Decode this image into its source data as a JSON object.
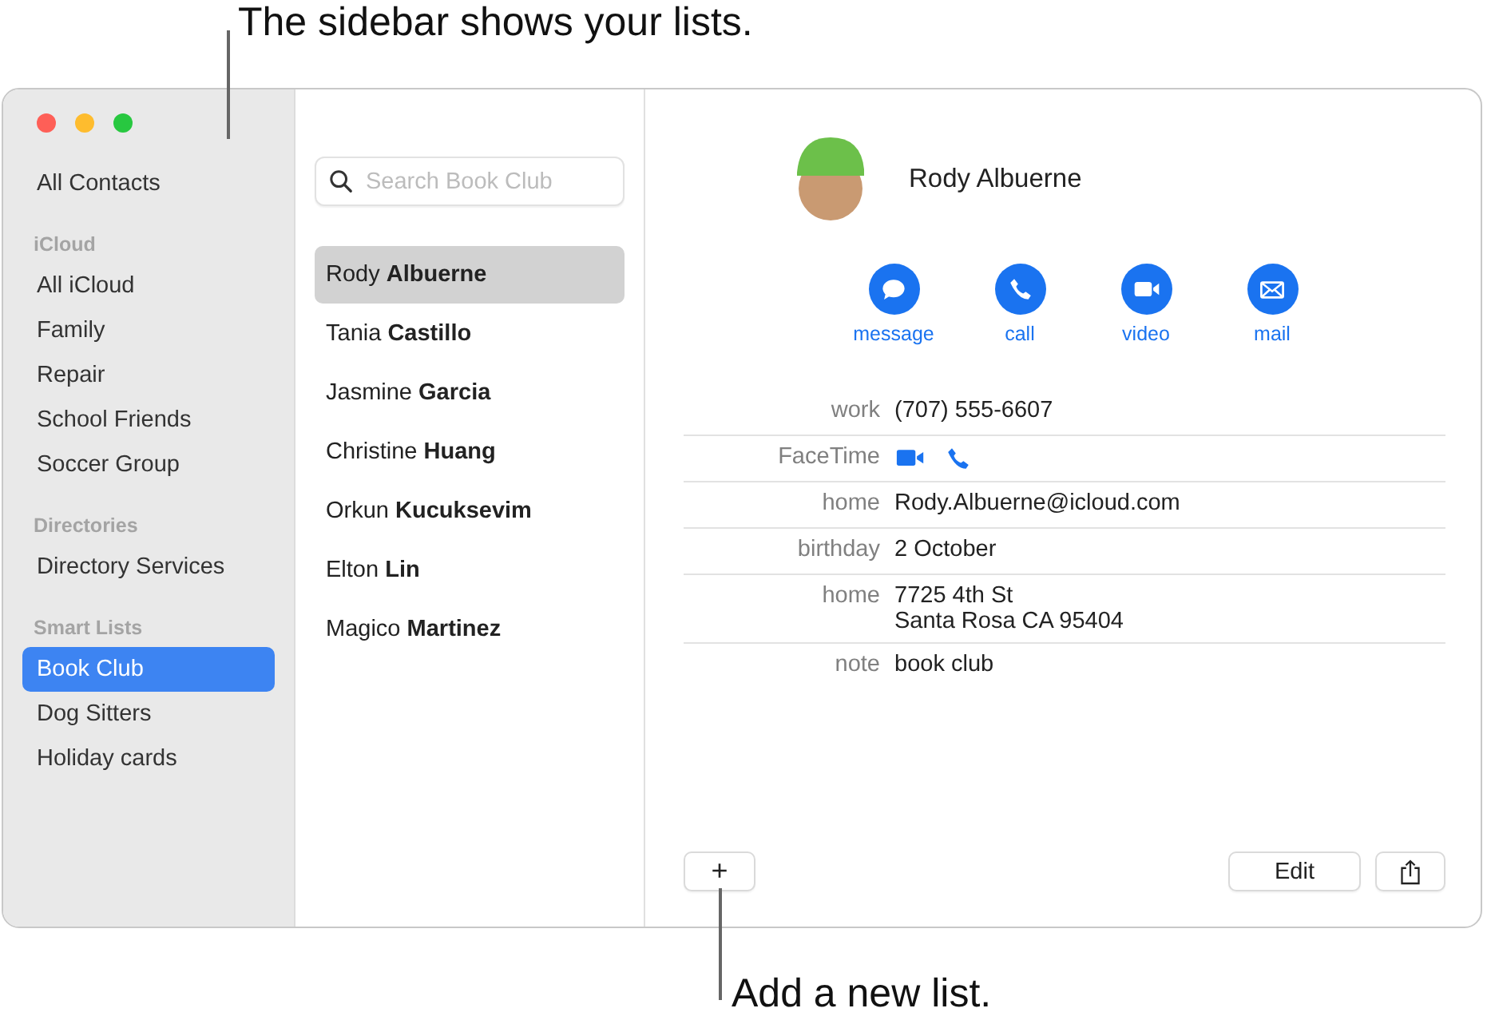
{
  "callouts": [
    {
      "kind": "sidebar",
      "text": "The sidebar shows your lists."
    },
    {
      "kind": "add",
      "text": "Add a new list."
    }
  ],
  "sidebar": {
    "top_item": {
      "label": "All Contacts",
      "selected": false
    },
    "sections": [
      {
        "heading": "iCloud",
        "items": [
          {
            "label": "All iCloud",
            "selected": false
          },
          {
            "label": "Family",
            "selected": false
          },
          {
            "label": "Repair",
            "selected": false
          },
          {
            "label": "School Friends",
            "selected": false
          },
          {
            "label": "Soccer Group",
            "selected": false
          }
        ]
      },
      {
        "heading": "Directories",
        "items": [
          {
            "label": "Directory Services",
            "selected": false
          }
        ]
      },
      {
        "heading": "Smart Lists",
        "items": [
          {
            "label": "Book Club",
            "selected": true
          },
          {
            "label": "Dog Sitters",
            "selected": false
          },
          {
            "label": "Holiday cards",
            "selected": false
          }
        ]
      }
    ]
  },
  "contact_list": {
    "search": {
      "placeholder": "Search Book Club"
    },
    "contacts": [
      {
        "name": "Rody **Albuerne**",
        "selected": true
      },
      {
        "name": "Tania **Castillo**",
        "selected": false
      },
      {
        "name": "Jasmine **Garcia**",
        "selected": false
      },
      {
        "name": "Christine **Huang**",
        "selected": false
      },
      {
        "name": "Orkun **Kucuksevim**",
        "selected": false
      },
      {
        "name": "Elton **Lin**",
        "selected": false
      },
      {
        "name": "Magico **Martinez**",
        "selected": false
      }
    ]
  },
  "detail": {
    "name": "Rody Albuerne",
    "actions": [
      {
        "kind": "message",
        "label": "message"
      },
      {
        "kind": "call",
        "label": "call"
      },
      {
        "kind": "video",
        "label": "video"
      },
      {
        "kind": "mail",
        "label": "mail"
      }
    ],
    "fields": [
      {
        "kind": "text",
        "label": "work",
        "value": [
          "(707) 555-6607"
        ]
      },
      {
        "kind": "facetime",
        "label": "FaceTime"
      },
      {
        "kind": "text",
        "label": "home",
        "value": [
          "Rody.Albuerne@icloud.com"
        ]
      },
      {
        "kind": "text",
        "label": "birthday",
        "value": [
          "2 October"
        ]
      },
      {
        "kind": "text",
        "label": "home",
        "value": [
          "7725 4th St",
          "Santa Rosa CA 95404"
        ]
      },
      {
        "kind": "text",
        "label": "note",
        "value": [
          "book club"
        ]
      }
    ],
    "add_button": "+",
    "edit_button": "Edit"
  }
}
